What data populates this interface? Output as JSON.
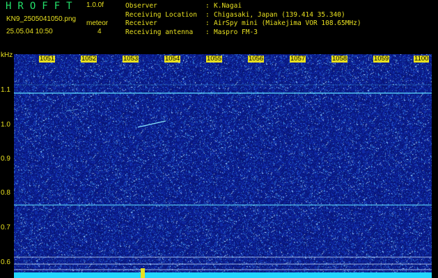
{
  "header": {
    "brand": "HROFFT",
    "version": "1.0.0f",
    "filename": "KN9_2505041050.png",
    "meteor_label": "meteor",
    "datetime": "25.05.04 10:50",
    "meteor_count": "4",
    "info": [
      {
        "key": "Observer",
        "value": "K.Nagai"
      },
      {
        "key": "Receiving Location",
        "value": "Chigasaki, Japan (139.414 35.340)"
      },
      {
        "key": "Receiver",
        "value": "AirSpy mini (Miakejima VOR 108.65MHz)"
      },
      {
        "key": "Receiving antenna",
        "value": "Maspro FM-3"
      }
    ]
  },
  "axis": {
    "y_unit": "kHz",
    "y_ticks": [
      "1.1",
      "1.0",
      "0.9",
      "0.8",
      "0.7",
      "0.6"
    ],
    "x_ticks": [
      "1051",
      "1052",
      "1053",
      "1054",
      "1055",
      "1056",
      "1057",
      "1058",
      "1059",
      "1100"
    ]
  },
  "colors": {
    "background": "#000000",
    "noise_base": "#0a1a8a",
    "signal": "#5fe0ff",
    "label": "#e8e020",
    "brand": "#23e06a"
  }
}
